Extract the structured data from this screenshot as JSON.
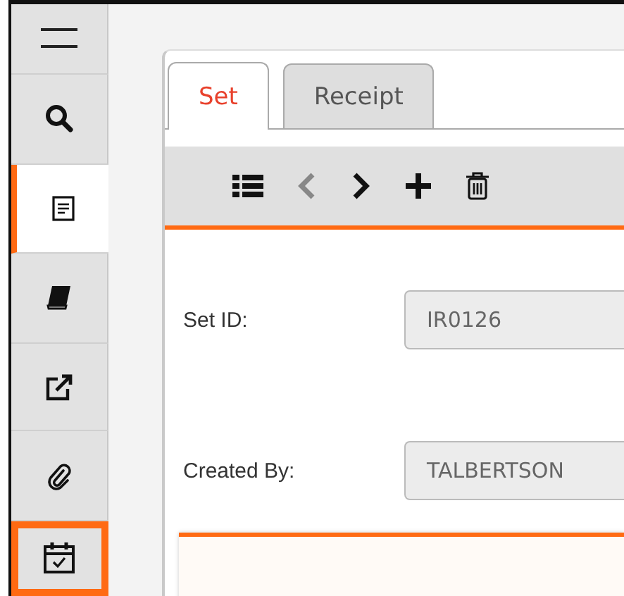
{
  "sidebar": {
    "items": [
      {
        "kind": "menu",
        "selected": false,
        "highlighted": false
      },
      {
        "kind": "search",
        "selected": false,
        "highlighted": false
      },
      {
        "kind": "document",
        "selected": true,
        "highlighted": false
      },
      {
        "kind": "book",
        "selected": false,
        "highlighted": false
      },
      {
        "kind": "external",
        "selected": false,
        "highlighted": false
      },
      {
        "kind": "attachment",
        "selected": false,
        "highlighted": false
      },
      {
        "kind": "calendar",
        "selected": false,
        "highlighted": true
      }
    ]
  },
  "tabs": [
    {
      "label": "Set",
      "selected": true
    },
    {
      "label": "Receipt",
      "selected": false
    }
  ],
  "toolbar": [
    {
      "kind": "list",
      "disabled": false
    },
    {
      "kind": "previous",
      "disabled": true
    },
    {
      "kind": "next",
      "disabled": false
    },
    {
      "kind": "add",
      "disabled": false
    },
    {
      "kind": "delete",
      "disabled": false
    }
  ],
  "fields": [
    {
      "label": "Set ID:",
      "value": "IR0126",
      "disabled": true
    },
    {
      "label": "Created By:",
      "value": "TALBERTSON",
      "disabled": true
    }
  ]
}
